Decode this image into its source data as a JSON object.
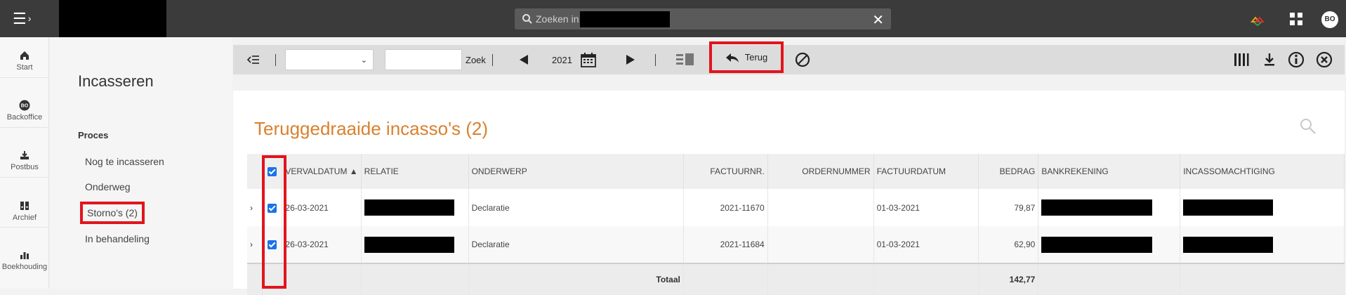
{
  "topbar": {
    "search_placeholder": "Zoeken in",
    "clear_icon": "close-icon",
    "user_initials": "BO",
    "menu_icon": "hamburger-chevron-icon"
  },
  "rail": {
    "items": [
      {
        "label": "Start",
        "icon": "home-icon"
      },
      {
        "label": "Backoffice",
        "icon": "bo-badge-icon",
        "badge": "BO"
      },
      {
        "label": "Postbus",
        "icon": "inbox-download-icon"
      },
      {
        "label": "Archief",
        "icon": "archive-icon"
      },
      {
        "label": "Boekhouding",
        "icon": "bar-chart-icon"
      }
    ]
  },
  "subnav": {
    "title": "Incasseren",
    "section": "Proces",
    "items": [
      {
        "label": "Nog te incasseren"
      },
      {
        "label": "Onderweg"
      },
      {
        "label": "Storno's (2)"
      },
      {
        "label": "In behandeling"
      }
    ]
  },
  "toolbar": {
    "zoek_label": "Zoek",
    "year": "2021",
    "terug_label": "Terug"
  },
  "panel": {
    "title": "Teruggedraaide incasso's (2)",
    "columns": [
      "VERVALDATUM ▲",
      "RELATIE",
      "ONDERWERP",
      "FACTUURNR.",
      "ORDERNUMMER",
      "FACTUURDATUM",
      "BEDRAG",
      "BANKREKENING",
      "INCASSOMACHTIGING"
    ],
    "rows": [
      {
        "vervaldatum": "26-03-2021",
        "onderwerp": "Declaratie",
        "factuurnr": "2021-11670",
        "factuurdatum": "01-03-2021",
        "bedrag": "79,87"
      },
      {
        "vervaldatum": "26-03-2021",
        "onderwerp": "Declaratie",
        "factuurnr": "2021-11684",
        "factuurdatum": "01-03-2021",
        "bedrag": "62,90"
      }
    ],
    "total_label": "Totaal",
    "total_value": "142,77"
  },
  "colors": {
    "accent_title": "#d9812e",
    "highlight": "#e1151d",
    "checkbox": "#1a73e8",
    "topbar": "#3b3b3b"
  }
}
